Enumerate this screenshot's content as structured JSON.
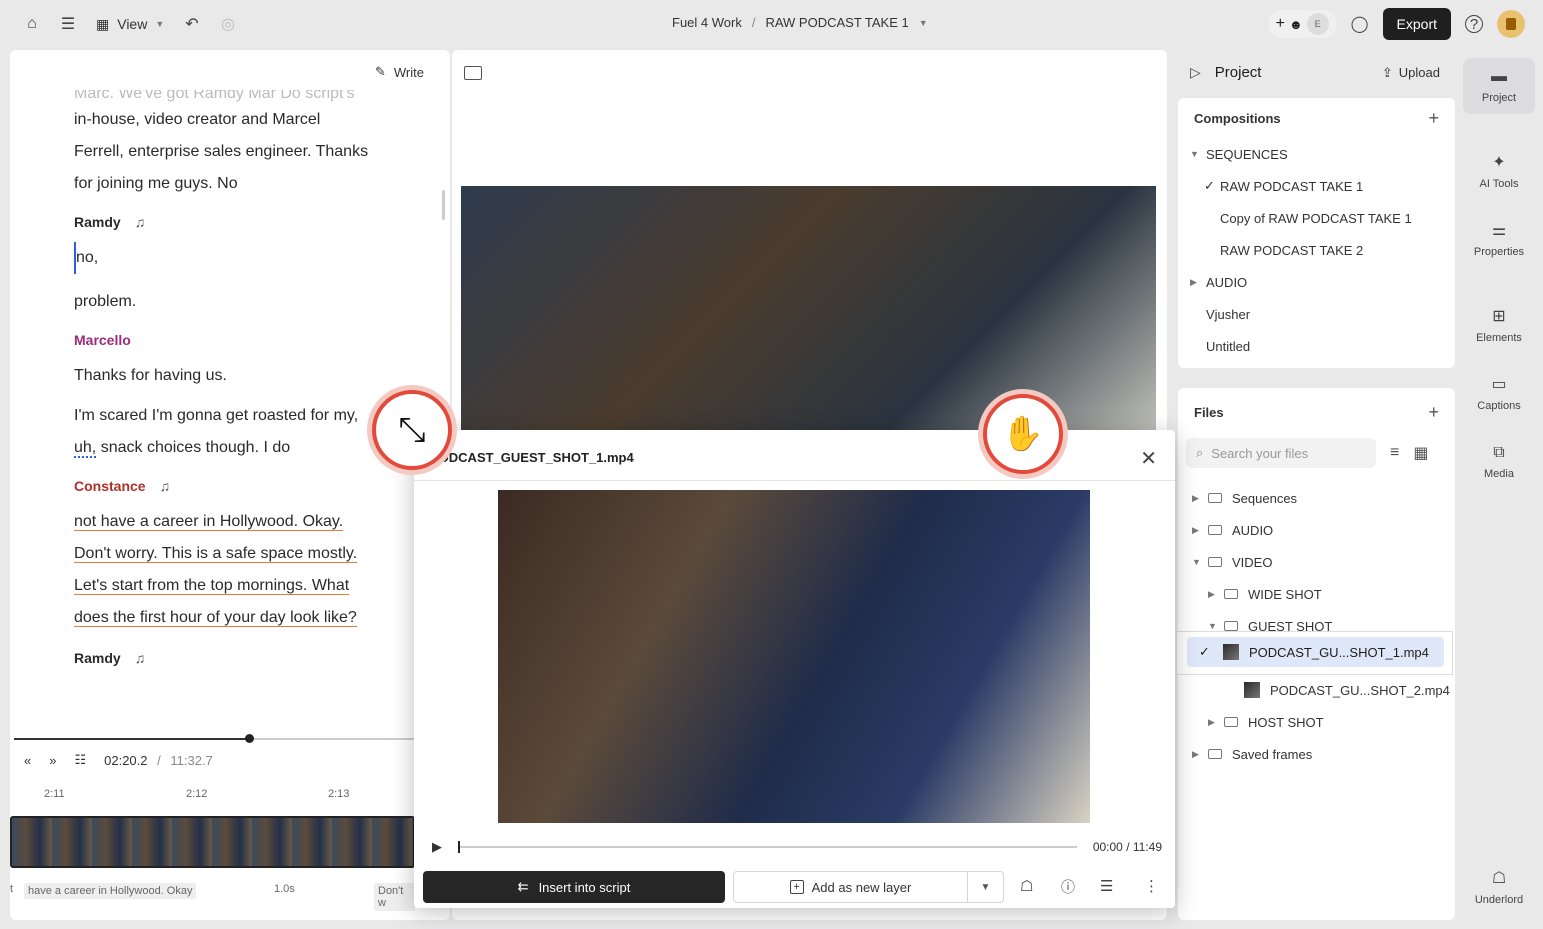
{
  "topbar": {
    "view_label": "View",
    "crumb_project": "Fuel 4 Work",
    "crumb_sep": "/",
    "crumb_comp": "RAW PODCAST TAKE 1",
    "avatar_letter": "E",
    "export_label": "Export"
  },
  "script": {
    "write_label": "Write",
    "lines": [
      "Marc. We've got Ramdy Mar Do script's",
      "in-house, video creator and Marcel",
      "Ferrell, enterprise sales engineer. Thanks",
      "for joining me guys. No"
    ],
    "speaker1": "Ramdy",
    "s1_line1": "no,",
    "s1_line2": "problem.",
    "speaker2": "Marcello",
    "s2_line1": "Thanks for having us.",
    "s2_line2": "I'm scared I'm gonna get roasted for my,",
    "s2_line3_uh": "uh,",
    "s2_line3": " snack choices though. I do",
    "speaker3": "Constance",
    "s3_lines": [
      "not have a career in Hollywood. Okay.",
      "Don't worry. This is a safe space mostly.",
      "Let's start from the top mornings. What",
      "does the first hour of your day look like?"
    ],
    "speaker4": "Ramdy",
    "colors": {
      "speaker_default": "#333333",
      "marcello": "#9b2c7a",
      "constance": "#b0302a",
      "underline": "#e07b39"
    }
  },
  "timeline": {
    "current": "02:20.2",
    "sep": "/",
    "total": "11:32.7",
    "ruler": [
      "2:11",
      "2:12",
      "2:13"
    ],
    "caption1": "have a career in Hollywood. Okay",
    "caption_dur": "1.0s",
    "caption2": "Don't w",
    "caption0": "t"
  },
  "project": {
    "title": "Project",
    "upload_label": "Upload",
    "compositions_title": "Compositions",
    "sequences_label": "SEQUENCES",
    "seq_items": [
      "RAW PODCAST TAKE 1",
      "Copy of RAW PODCAST TAKE 1",
      "RAW PODCAST TAKE 2"
    ],
    "audio_label": "AUDIO",
    "other_items": [
      "Vjusher",
      "Untitled"
    ],
    "files_title": "Files",
    "search_placeholder": "Search your files",
    "file_tree": {
      "sequences": "Sequences",
      "audio": "AUDIO",
      "video": "VIDEO",
      "wide": "WIDE SHOT",
      "guest": "GUEST SHOT",
      "file1": "PODCAST_GU...SHOT_1.mp4",
      "file2": "PODCAST_GU...SHOT_2.mp4",
      "host": "HOST SHOT",
      "saved": "Saved frames"
    }
  },
  "sidebar": {
    "items": [
      "Project",
      "AI Tools",
      "Properties",
      "Elements",
      "Captions",
      "Media",
      "Underlord"
    ]
  },
  "modal": {
    "title": "PODCAST_GUEST_SHOT_1.mp4",
    "time": "00:00 / 11:49",
    "insert_label": "Insert into script",
    "add_layer_label": "Add as new layer"
  }
}
